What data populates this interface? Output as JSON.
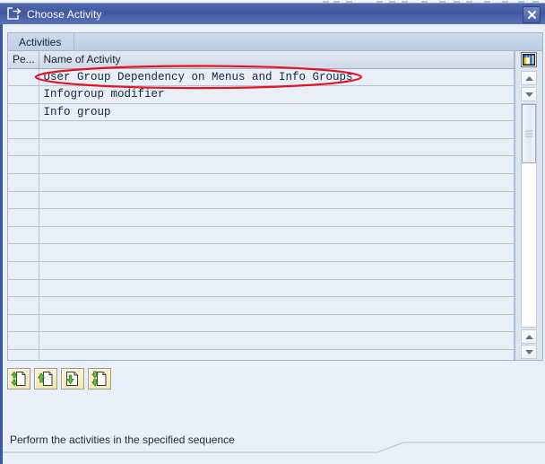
{
  "window": {
    "title": "Choose Activity",
    "title_icon": "dialog-window-icon",
    "close_label": "x",
    "close_icon": "close-icon",
    "titlebar_color": "#3f58a0"
  },
  "tabstrip": {
    "tabs": [
      {
        "label": "Activities",
        "active": true
      }
    ]
  },
  "grid": {
    "columns": [
      {
        "key": "pe",
        "label": "Pe..."
      },
      {
        "key": "name",
        "label": "Name of Activity"
      }
    ],
    "rows": [
      {
        "pe": "",
        "name": "User Group Dependency on Menus and Info Groups",
        "highlighted": true
      },
      {
        "pe": "",
        "name": "Infogroup modifier"
      },
      {
        "pe": "",
        "name": "Info group"
      },
      {
        "pe": "",
        "name": ""
      },
      {
        "pe": "",
        "name": ""
      },
      {
        "pe": "",
        "name": ""
      },
      {
        "pe": "",
        "name": ""
      },
      {
        "pe": "",
        "name": ""
      },
      {
        "pe": "",
        "name": ""
      },
      {
        "pe": "",
        "name": ""
      },
      {
        "pe": "",
        "name": ""
      },
      {
        "pe": "",
        "name": ""
      },
      {
        "pe": "",
        "name": ""
      },
      {
        "pe": "",
        "name": ""
      },
      {
        "pe": "",
        "name": ""
      },
      {
        "pe": "",
        "name": ""
      },
      {
        "pe": "",
        "name": ""
      }
    ],
    "annotation": {
      "shape": "ellipse",
      "color": "#e81123",
      "targets_row": 0
    }
  },
  "scrollbar": {
    "config_icon": "column-settings-icon",
    "up_icon": "scroll-up-icon",
    "down_icon": "scroll-down-icon"
  },
  "toolbar": {
    "buttons": [
      {
        "name": "choose-activity-button",
        "icon": "document-up-down-icon"
      },
      {
        "name": "previous-activity-button",
        "icon": "document-up-icon"
      },
      {
        "name": "next-activity-button",
        "icon": "document-down-icon"
      },
      {
        "name": "last-activity-button",
        "icon": "document-double-down-icon"
      }
    ]
  },
  "status": {
    "message": "Perform the activities in the specified sequence"
  }
}
